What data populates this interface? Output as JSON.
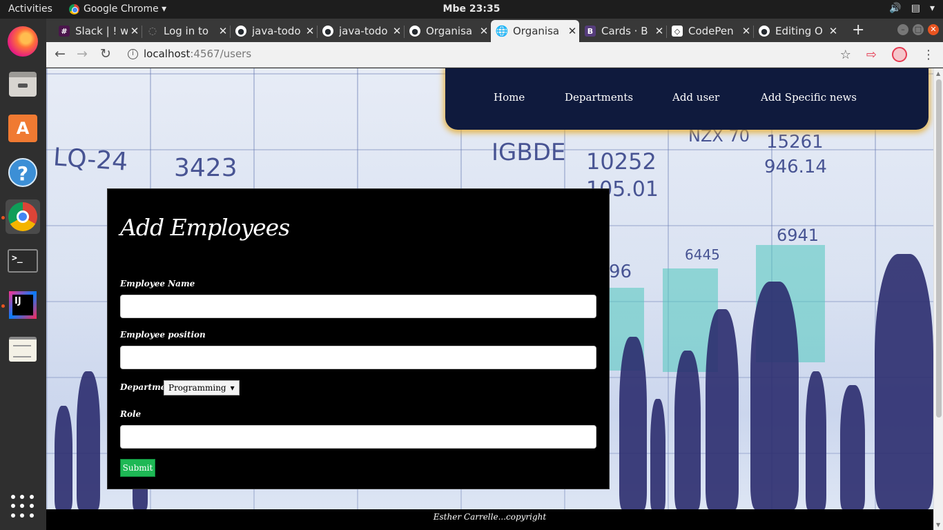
{
  "system": {
    "activities": "Activities",
    "app_menu": "Google Chrome ▾",
    "clock": "Mbe 23:35",
    "sys_icons": [
      "volume-icon",
      "clipboard-icon",
      "power-menu-icon"
    ]
  },
  "dock": {
    "items": [
      "firefox-icon",
      "files-icon",
      "software-store-icon",
      "help-icon",
      "chrome-icon",
      "terminal-icon",
      "intellij-icon",
      "text-editor-icon",
      "app-grid-icon"
    ]
  },
  "tabs": [
    {
      "title": "Slack | ! w",
      "favicon": "slack-icon",
      "color": "#4a154b"
    },
    {
      "title": "Log in to",
      "favicon": "spinner-icon",
      "color": "#555555"
    },
    {
      "title": "java-todo",
      "favicon": "github-icon",
      "color": "#24292e"
    },
    {
      "title": "java-todo",
      "favicon": "github-icon",
      "color": "#24292e"
    },
    {
      "title": "Organisa",
      "favicon": "github-icon",
      "color": "#24292e"
    },
    {
      "title": "Organisa",
      "favicon": "globe-icon",
      "color": "#555555"
    },
    {
      "title": "Cards · B",
      "favicon": "bootstrap-icon",
      "color": "#563d7c"
    },
    {
      "title": "CodePen",
      "favicon": "codepen-icon",
      "color": "#222222"
    },
    {
      "title": "Editing O",
      "favicon": "github-icon",
      "color": "#24292e"
    }
  ],
  "browser": {
    "url_host": "localhost",
    "url_path": ":4567/users",
    "new_tab": "+"
  },
  "nav": {
    "items": [
      "Home",
      "Departments",
      "Add user",
      "Add Specific news"
    ]
  },
  "background_text": [
    "LQ-24",
    "3423",
    "IGBDE",
    "10252",
    "105.01",
    "NZX 70",
    "15261",
    "946.14",
    "6941",
    "6445",
    "96"
  ],
  "form": {
    "title": "Add Employees",
    "name_label": "Employee Name",
    "name_value": "",
    "position_label": "Employee position",
    "position_value": "",
    "department_label": "Department",
    "department_selected": "Programming",
    "role_label": "Role",
    "role_value": "",
    "submit_label": "Submit"
  },
  "footer": {
    "text": "Esther Carrelle...copyright"
  },
  "colors": {
    "nav_bg": "#0f1a3d",
    "nav_glow": "#e6aa28",
    "card_bg": "#000000",
    "submit_bg": "#1eb855"
  }
}
